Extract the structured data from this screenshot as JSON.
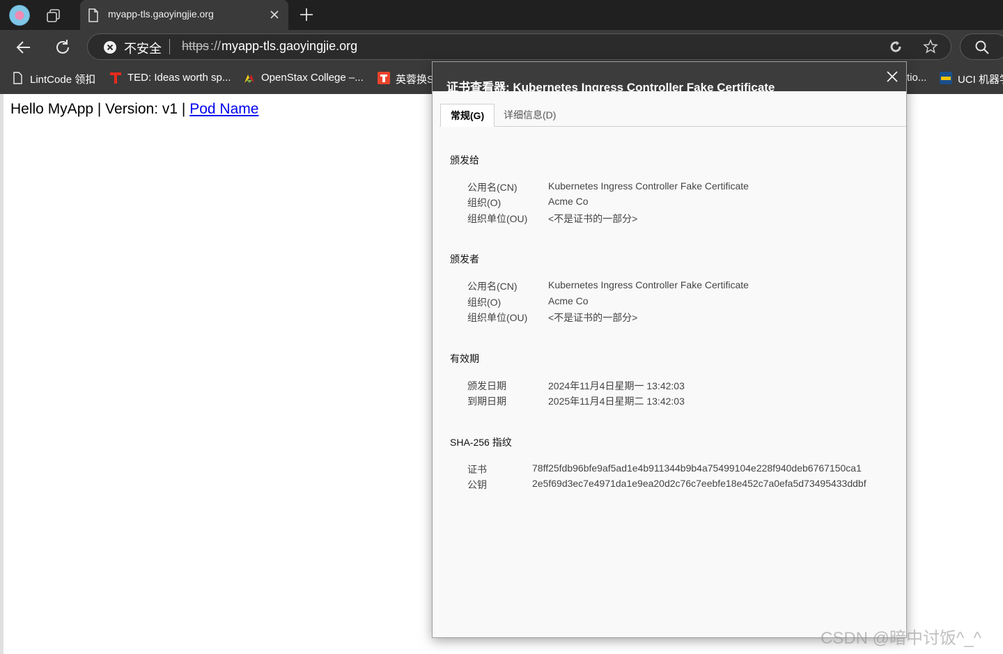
{
  "browser": {
    "tab": {
      "title": "myapp-tls.gaoyingjie.org"
    },
    "address": {
      "security_label": "不安全",
      "scheme": "https",
      "scheme_sep": "://",
      "host": "myapp-tls.gaoyingjie.org"
    },
    "bookmarks": [
      {
        "label": "LintCode 领扣",
        "icon": "file-icon"
      },
      {
        "label": "TED: Ideas worth sp...",
        "icon": "ted-icon"
      },
      {
        "label": "OpenStax College –...",
        "icon": "openstax-icon"
      },
      {
        "label": "英蓉换S",
        "icon": "translate-icon"
      },
      {
        "label": "tio...",
        "icon": ""
      },
      {
        "label": "UCI 机器学",
        "icon": "uci-icon"
      }
    ],
    "colors": {
      "chrome_dark": "#202020",
      "toolbar": "#3a3a3a",
      "link": "#0000ee"
    }
  },
  "page": {
    "text": "Hello MyApp | Version: v1 | ",
    "link": "Pod Name"
  },
  "cert_dialog": {
    "title": "证书查看器: Kubernetes Ingress Controller Fake Certificate",
    "tabs": [
      {
        "label": "常规(G)",
        "active": true
      },
      {
        "label": "详细信息(D)",
        "active": false
      }
    ],
    "issued_to": {
      "heading": "颁发给",
      "rows": [
        {
          "key": "公用名(CN)",
          "value": "Kubernetes Ingress Controller Fake Certificate"
        },
        {
          "key": "组织(O)",
          "value": "Acme Co"
        },
        {
          "key": "组织单位(OU)",
          "value": "<不是证书的一部分>"
        }
      ]
    },
    "issued_by": {
      "heading": "颁发者",
      "rows": [
        {
          "key": "公用名(CN)",
          "value": "Kubernetes Ingress Controller Fake Certificate"
        },
        {
          "key": "组织(O)",
          "value": "Acme Co"
        },
        {
          "key": "组织单位(OU)",
          "value": "<不是证书的一部分>"
        }
      ]
    },
    "validity": {
      "heading": "有效期",
      "rows": [
        {
          "key": "颁发日期",
          "value": "2024年11月4日星期一 13:42:03"
        },
        {
          "key": "到期日期",
          "value": "2025年11月4日星期二 13:42:03"
        }
      ]
    },
    "fingerprints": {
      "heading": "SHA-256 指纹",
      "rows": [
        {
          "key": "证书",
          "value": "78ff25fdb96bfe9af5ad1e4b911344b9b4a75499104e228f940deb6767150ca1"
        },
        {
          "key": "公钥",
          "value": "2e5f69d3ec7e4971da1e9ea20d2c76c7eebfe18e452c7a0efa5d73495433ddbf"
        }
      ]
    }
  },
  "watermark": "CSDN @暗中讨饭^_^"
}
